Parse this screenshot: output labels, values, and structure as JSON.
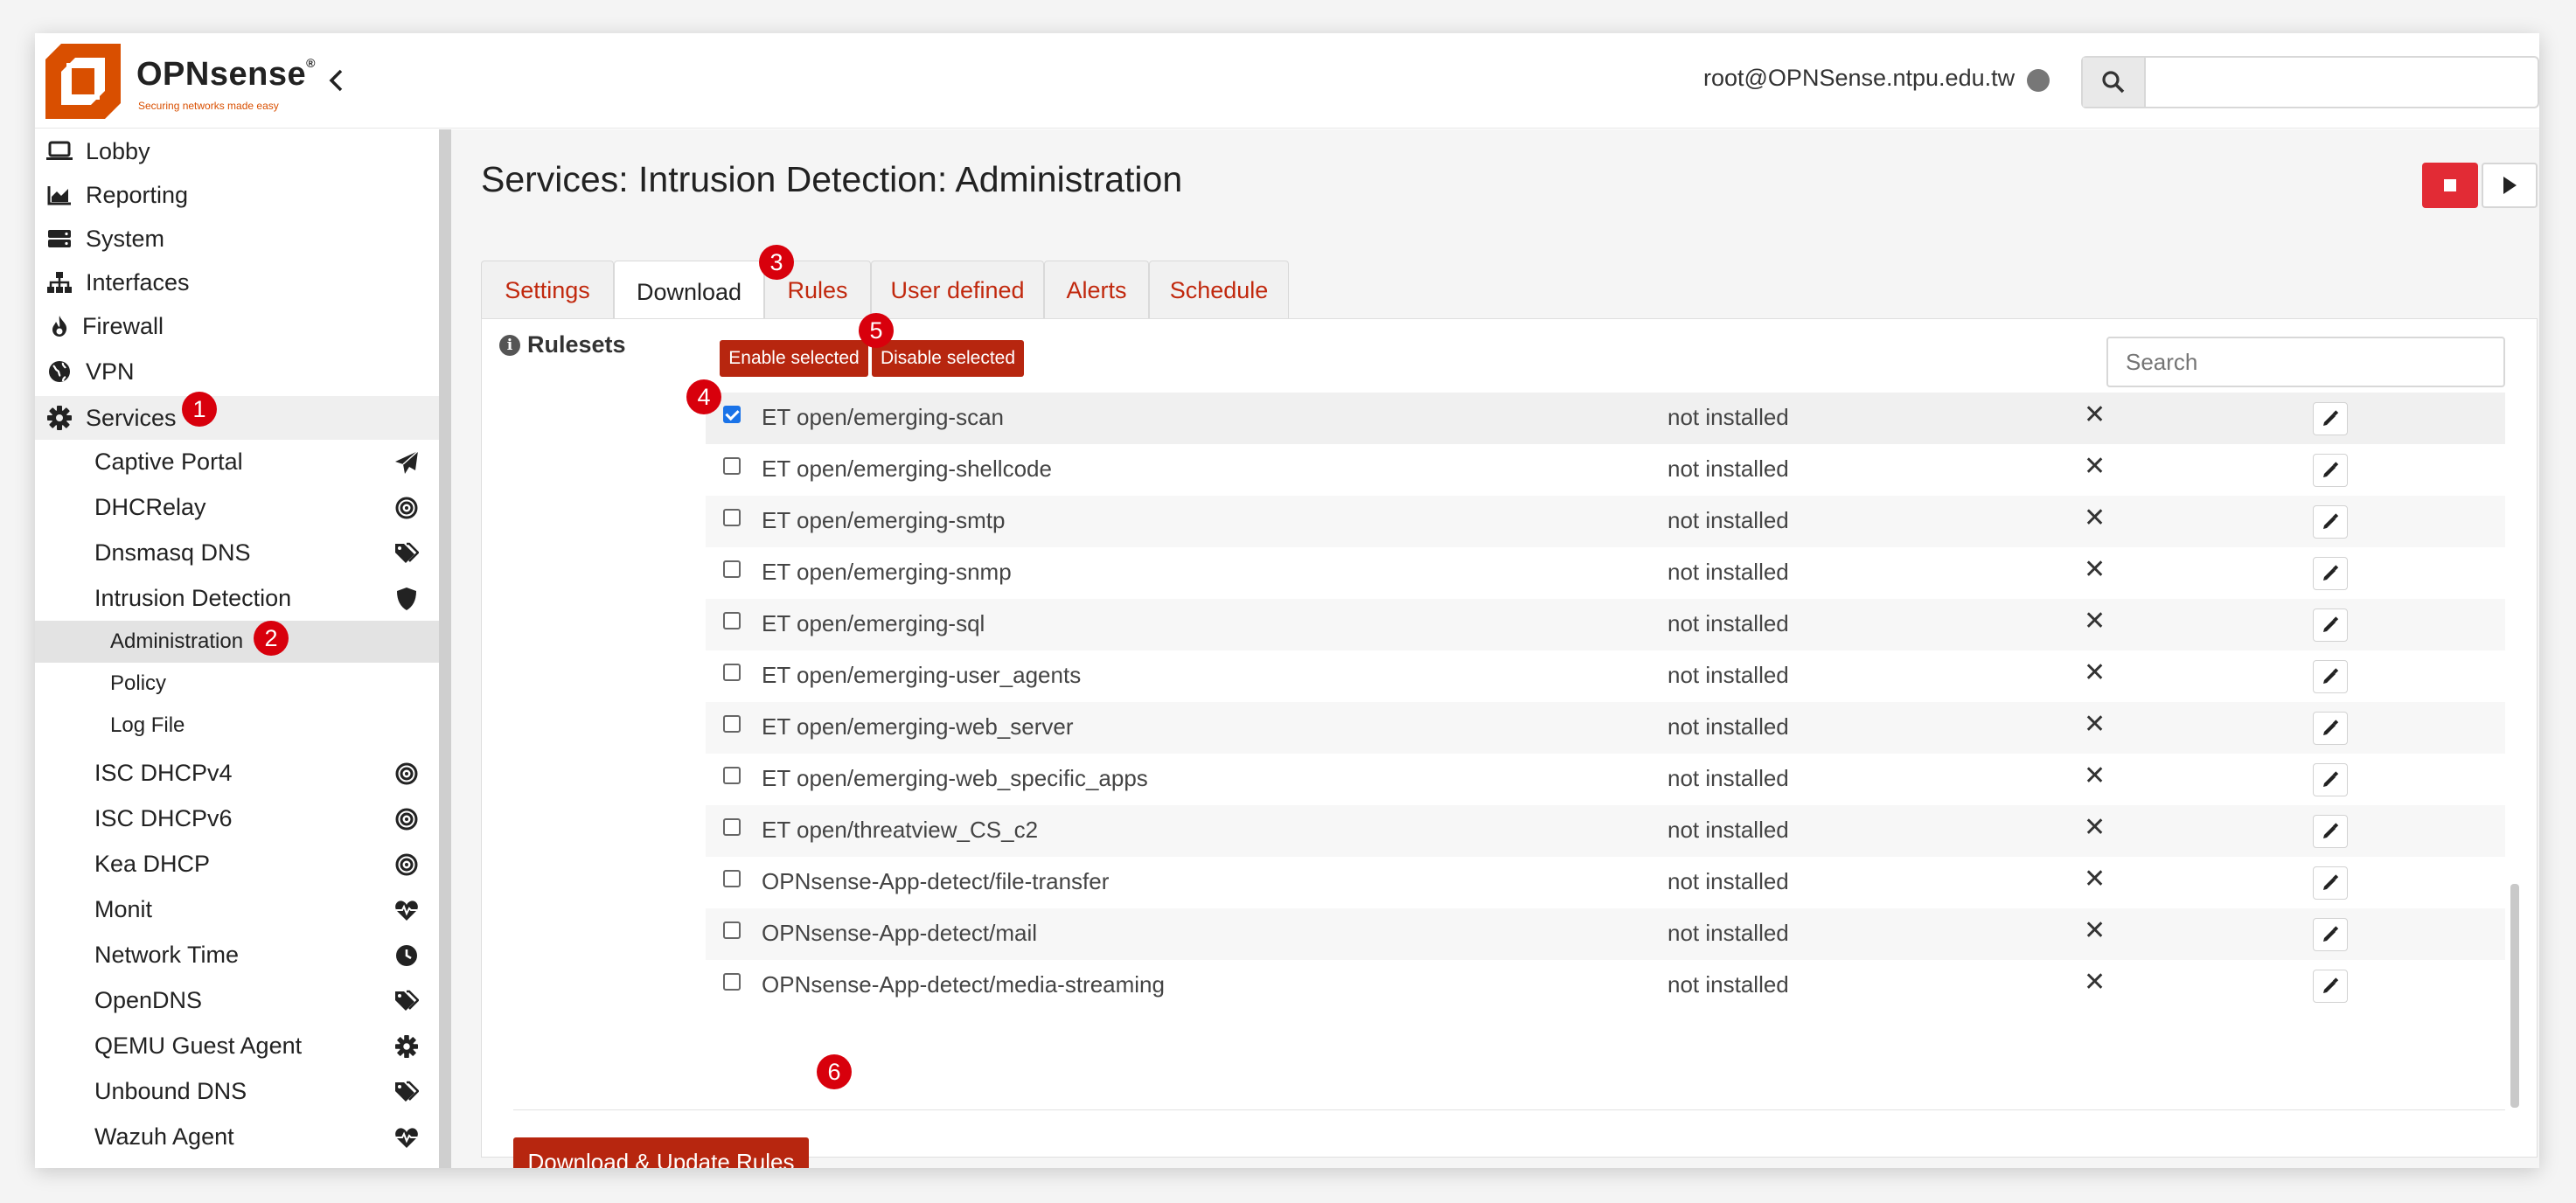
{
  "header": {
    "brand": "OPNsense",
    "brand_reg": "®",
    "tagline": "Securing networks made easy",
    "user": "root@OPNSense.ntpu.edu.tw",
    "search_placeholder": ""
  },
  "sidebar": {
    "items": [
      {
        "label": "Lobby",
        "icon": "laptop-icon"
      },
      {
        "label": "Reporting",
        "icon": "area-chart-icon"
      },
      {
        "label": "System",
        "icon": "server-icon"
      },
      {
        "label": "Interfaces",
        "icon": "sitemap-icon"
      },
      {
        "label": "Firewall",
        "icon": "fire-icon"
      },
      {
        "label": "VPN",
        "icon": "globe-icon"
      },
      {
        "label": "Services",
        "icon": "gear-icon"
      }
    ],
    "services": [
      {
        "label": "Captive Portal",
        "icon": "paper-plane-icon"
      },
      {
        "label": "DHCRelay",
        "icon": "bullseye-icon"
      },
      {
        "label": "Dnsmasq DNS",
        "icon": "tags-icon"
      },
      {
        "label": "Intrusion Detection",
        "icon": "shield-icon"
      },
      {
        "label": "ISC DHCPv4",
        "icon": "bullseye-icon"
      },
      {
        "label": "ISC DHCPv6",
        "icon": "bullseye-icon"
      },
      {
        "label": "Kea DHCP",
        "icon": "bullseye-icon"
      },
      {
        "label": "Monit",
        "icon": "heartbeat-icon"
      },
      {
        "label": "Network Time",
        "icon": "clock-icon"
      },
      {
        "label": "OpenDNS",
        "icon": "tags-icon"
      },
      {
        "label": "QEMU Guest Agent",
        "icon": "gear-icon"
      },
      {
        "label": "Unbound DNS",
        "icon": "tags-icon"
      },
      {
        "label": "Wazuh Agent",
        "icon": "heartbeat-icon"
      }
    ],
    "ids_sub": [
      "Administration",
      "Policy",
      "Log File"
    ]
  },
  "main": {
    "title": "Services: Intrusion Detection: Administration",
    "tabs": [
      "Settings",
      "Download",
      "Rules",
      "User defined",
      "Alerts",
      "Schedule"
    ],
    "active_tab": "Download",
    "rulesets_label": "Rulesets",
    "enable_selected": "Enable selected",
    "disable_selected": "Disable selected",
    "grid_search_placeholder": "Search",
    "download_button": "Download & Update Rules"
  },
  "rulesets": [
    {
      "name": "ET open/emerging-scan",
      "status": "not installed",
      "enabled": "✕",
      "checked": true
    },
    {
      "name": "ET open/emerging-shellcode",
      "status": "not installed",
      "enabled": "✕",
      "checked": false
    },
    {
      "name": "ET open/emerging-smtp",
      "status": "not installed",
      "enabled": "✕",
      "checked": false
    },
    {
      "name": "ET open/emerging-snmp",
      "status": "not installed",
      "enabled": "✕",
      "checked": false
    },
    {
      "name": "ET open/emerging-sql",
      "status": "not installed",
      "enabled": "✕",
      "checked": false
    },
    {
      "name": "ET open/emerging-user_agents",
      "status": "not installed",
      "enabled": "✕",
      "checked": false
    },
    {
      "name": "ET open/emerging-web_server",
      "status": "not installed",
      "enabled": "✕",
      "checked": false
    },
    {
      "name": "ET open/emerging-web_specific_apps",
      "status": "not installed",
      "enabled": "✕",
      "checked": false
    },
    {
      "name": "ET open/threatview_CS_c2",
      "status": "not installed",
      "enabled": "✕",
      "checked": false
    },
    {
      "name": "OPNsense-App-detect/file-transfer",
      "status": "not installed",
      "enabled": "✕",
      "checked": false
    },
    {
      "name": "OPNsense-App-detect/mail",
      "status": "not installed",
      "enabled": "✕",
      "checked": false
    },
    {
      "name": "OPNsense-App-detect/media-streaming",
      "status": "not installed",
      "enabled": "✕",
      "checked": false
    }
  ],
  "annotations": [
    "1",
    "2",
    "3",
    "4",
    "5",
    "6"
  ],
  "colors": {
    "accent": "#b7260f",
    "brand_orange": "#d94f00",
    "badge": "#d8000c",
    "stop": "#e22b35"
  }
}
